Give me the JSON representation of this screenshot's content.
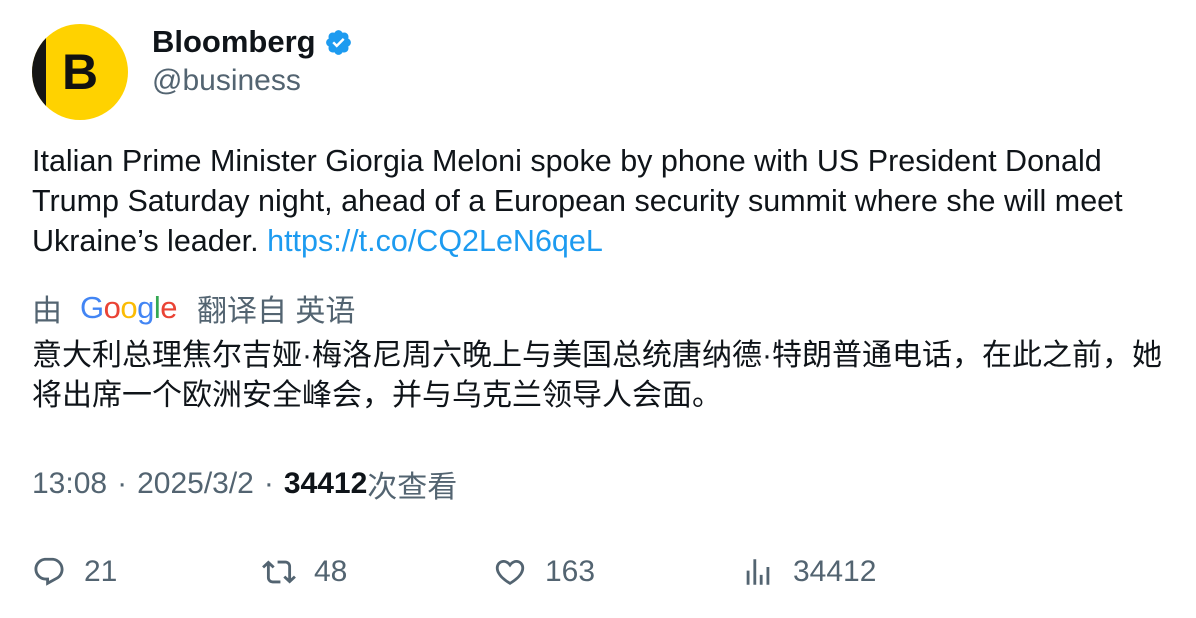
{
  "author": {
    "avatar_letter": "B",
    "display_name": "Bloomberg",
    "handle": "@business",
    "verified": true
  },
  "tweet": {
    "text": "Italian Prime Minister Giorgia Meloni spoke by phone with US President Donald Trump Saturday night, ahead of a European security summit where she will meet Ukraine’s leader.",
    "link": "https://t.co/CQ2LeN6qeL"
  },
  "translation": {
    "by_label": "由",
    "provider": "Google",
    "source_label": "翻译自 英语",
    "text": "意大利总理焦尔吉娅·梅洛尼周六晚上与美国总统唐纳德·特朗普通电话，在此之前，她将出席一个欧洲安全峰会，并与乌克兰领导人会面。"
  },
  "meta": {
    "time": "13:08",
    "separator": "·",
    "date": "2025/3/2",
    "views_count": "34412",
    "views_label": "次查看"
  },
  "actions": {
    "replies": "21",
    "retweets": "48",
    "likes": "163",
    "views": "34412"
  },
  "colors": {
    "text": "#0f1419",
    "secondary": "#536471",
    "link": "#1d9bf0",
    "verified": "#1d9bf0",
    "avatar_bg": "#FFD200"
  },
  "icons": [
    "verified-badge-icon",
    "reply-icon",
    "retweet-icon",
    "like-icon",
    "views-icon"
  ]
}
